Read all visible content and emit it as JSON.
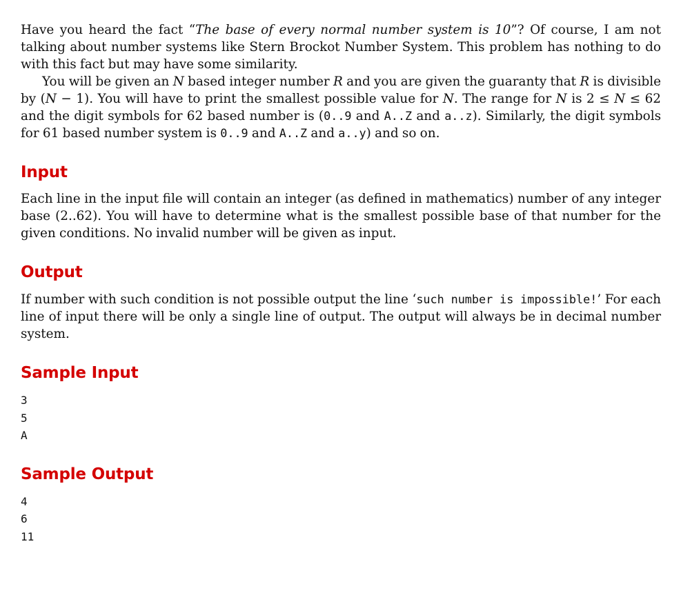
{
  "intro": {
    "p1_a": "Have you heard the fact “",
    "p1_quote": "The base of every normal number system is 10",
    "p1_b": "”? Of course, I am not talking about number systems like Stern Brockot Number System. This problem has nothing to do with this fact but may have some similarity.",
    "p2_a": "You will be given an ",
    "p2_N1": "N",
    "p2_b": " based integer number ",
    "p2_R1": "R",
    "p2_c": " and you are given the guaranty that ",
    "p2_R2": "R",
    "p2_d": " is divisible by (",
    "p2_N2": "N",
    "p2_e": " − 1). You will have to print the smallest possible value for ",
    "p2_N3": "N",
    "p2_f": ". The range for ",
    "p2_N4": "N",
    "p2_g": " is 2 ≤ ",
    "p2_N5": "N",
    "p2_h": " ≤ 62 and the digit symbols for 62 based number is (",
    "code_09_a": "0..9",
    "p2_and1": " and ",
    "code_AZ_a": "A..Z",
    "p2_and2": " and ",
    "code_az": "a..z",
    "p2_i": "). Similarly, the digit symbols for 61 based number system is ",
    "code_09_b": "0..9",
    "p2_and3": " and ",
    "code_AZ_b": "A..Z",
    "p2_and4": " and ",
    "code_ay": "a..y",
    "p2_j": ") and so on."
  },
  "input": {
    "heading": "Input",
    "text": "Each line in the input file will contain an integer (as defined in mathematics) number of any integer base (2..62). You will have to determine what is the smallest possible base of that number for the given conditions. No invalid number will be given as input."
  },
  "output": {
    "heading": "Output",
    "text_a": "If number with such condition is not possible output the line ‘",
    "code": "such number is impossible!",
    "text_b": "’ For each line of input there will be only a single line of output. The output will always be in decimal number system."
  },
  "sample_input": {
    "heading": "Sample Input",
    "lines": "3\n5\nA"
  },
  "sample_output": {
    "heading": "Sample Output",
    "lines": "4\n6\n11"
  }
}
